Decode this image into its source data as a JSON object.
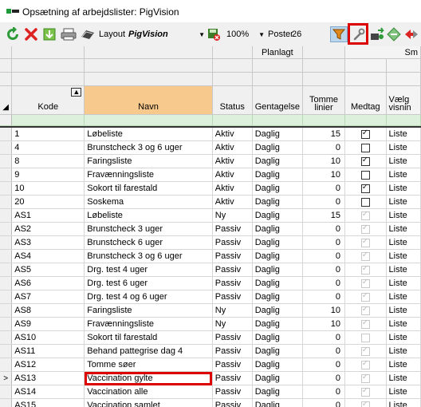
{
  "window": {
    "title": "Opsætning af arbejdslister: PigVision"
  },
  "toolbar": {
    "layout_label": "Layout",
    "layout_value": "PigVision",
    "zoom_value": "100%",
    "poster_label": "Poster",
    "poster_count": "26"
  },
  "columns": {
    "group_planlagt": "Planlagt",
    "group_sm": "Sm",
    "kode": "Kode",
    "navn": "Navn",
    "status": "Status",
    "gentagelse": "Gentagelse",
    "tomme_linier": "Tomme linier",
    "medtag": "Medtag",
    "visning": "Vælg visnin"
  },
  "rows": [
    {
      "kode": "1",
      "navn": "Løbeliste",
      "status": "Aktiv",
      "gentagelse": "Daglig",
      "tomme": "15",
      "medtag": true,
      "visning": "Liste"
    },
    {
      "kode": "4",
      "navn": "Brunstcheck 3 og 6 uger",
      "status": "Aktiv",
      "gentagelse": "Daglig",
      "tomme": "0",
      "medtag": false,
      "visning": "Liste"
    },
    {
      "kode": "8",
      "navn": "Faringsliste",
      "status": "Aktiv",
      "gentagelse": "Daglig",
      "tomme": "10",
      "medtag": true,
      "visning": "Liste"
    },
    {
      "kode": "9",
      "navn": "Fravænningsliste",
      "status": "Aktiv",
      "gentagelse": "Daglig",
      "tomme": "10",
      "medtag": false,
      "visning": "Liste"
    },
    {
      "kode": "10",
      "navn": "Sokort til farestald",
      "status": "Aktiv",
      "gentagelse": "Daglig",
      "tomme": "0",
      "medtag": true,
      "visning": "Liste"
    },
    {
      "kode": "20",
      "navn": "Soskema",
      "status": "Aktiv",
      "gentagelse": "Daglig",
      "tomme": "0",
      "medtag": false,
      "visning": "Liste"
    },
    {
      "kode": "AS1",
      "navn": "Løbeliste",
      "status": "Ny",
      "gentagelse": "Daglig",
      "tomme": "15",
      "medtag": true,
      "visning": "Liste"
    },
    {
      "kode": "AS2",
      "navn": "Brunstcheck 3 uger",
      "status": "Passiv",
      "gentagelse": "Daglig",
      "tomme": "0",
      "medtag": true,
      "visning": "Liste"
    },
    {
      "kode": "AS3",
      "navn": "Brunstcheck 6 uger",
      "status": "Passiv",
      "gentagelse": "Daglig",
      "tomme": "0",
      "medtag": true,
      "visning": "Liste"
    },
    {
      "kode": "AS4",
      "navn": "Brunstcheck 3 og 6 uger",
      "status": "Passiv",
      "gentagelse": "Daglig",
      "tomme": "0",
      "medtag": true,
      "visning": "Liste"
    },
    {
      "kode": "AS5",
      "navn": "Drg. test 4 uger",
      "status": "Passiv",
      "gentagelse": "Daglig",
      "tomme": "0",
      "medtag": true,
      "visning": "Liste"
    },
    {
      "kode": "AS6",
      "navn": "Drg. test 6 uger",
      "status": "Passiv",
      "gentagelse": "Daglig",
      "tomme": "0",
      "medtag": true,
      "visning": "Liste"
    },
    {
      "kode": "AS7",
      "navn": "Drg. test 4 og 6 uger",
      "status": "Passiv",
      "gentagelse": "Daglig",
      "tomme": "0",
      "medtag": true,
      "visning": "Liste"
    },
    {
      "kode": "AS8",
      "navn": "Faringsliste",
      "status": "Ny",
      "gentagelse": "Daglig",
      "tomme": "10",
      "medtag": true,
      "visning": "Liste"
    },
    {
      "kode": "AS9",
      "navn": "Fravænningsliste",
      "status": "Ny",
      "gentagelse": "Daglig",
      "tomme": "10",
      "medtag": true,
      "visning": "Liste"
    },
    {
      "kode": "AS10",
      "navn": "Sokort til farestald",
      "status": "Passiv",
      "gentagelse": "Daglig",
      "tomme": "0",
      "medtag": false,
      "visning": "Liste"
    },
    {
      "kode": "AS11",
      "navn": "Behand pattegrise dag 4",
      "status": "Passiv",
      "gentagelse": "Daglig",
      "tomme": "0",
      "medtag": true,
      "visning": "Liste"
    },
    {
      "kode": "AS12",
      "navn": "Tomme søer",
      "status": "Passiv",
      "gentagelse": "Daglig",
      "tomme": "0",
      "medtag": true,
      "visning": "Liste"
    },
    {
      "kode": "AS13",
      "navn": "Vaccination gylte",
      "status": "Passiv",
      "gentagelse": "Daglig",
      "tomme": "0",
      "medtag": true,
      "visning": "Liste",
      "current": true
    },
    {
      "kode": "AS14",
      "navn": "Vaccination alle",
      "status": "Passiv",
      "gentagelse": "Daglig",
      "tomme": "0",
      "medtag": true,
      "visning": "Liste"
    },
    {
      "kode": "AS15",
      "navn": "Vaccination samlet",
      "status": "Passiv",
      "gentagelse": "Daglig",
      "tomme": "0",
      "medtag": true,
      "visning": "Liste"
    }
  ],
  "current_row_marker": ">",
  "icons": [
    "refresh-icon",
    "delete-icon",
    "export-icon",
    "print-icon",
    "layout-icon",
    "save-layout-icon",
    "filter-icon",
    "wrench-icon",
    "move-icon",
    "diamond-icon",
    "red-arrows-icon"
  ],
  "colors": {
    "navn_header": "#f8c98c",
    "filter_row": "#dcf0dc",
    "highlight_box": "#d00"
  }
}
